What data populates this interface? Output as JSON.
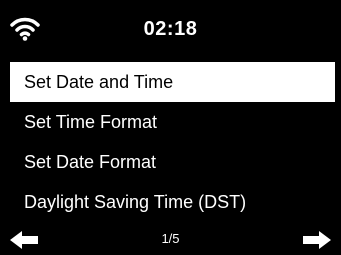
{
  "header": {
    "status_icon": "wifi-icon",
    "time": "02:18"
  },
  "menu": {
    "items": [
      {
        "label": "Set Date and Time",
        "selected": true
      },
      {
        "label": "Set Time Format",
        "selected": false
      },
      {
        "label": "Set Date Format",
        "selected": false
      },
      {
        "label": "Daylight Saving Time (DST)",
        "selected": false
      }
    ]
  },
  "footer": {
    "left_icon": "arrow-left-icon",
    "page_indicator": "1/5",
    "right_icon": "arrow-right-icon"
  },
  "colors": {
    "background": "#000000",
    "text": "#ffffff",
    "selected_background": "#ffffff",
    "selected_text": "#000000"
  }
}
